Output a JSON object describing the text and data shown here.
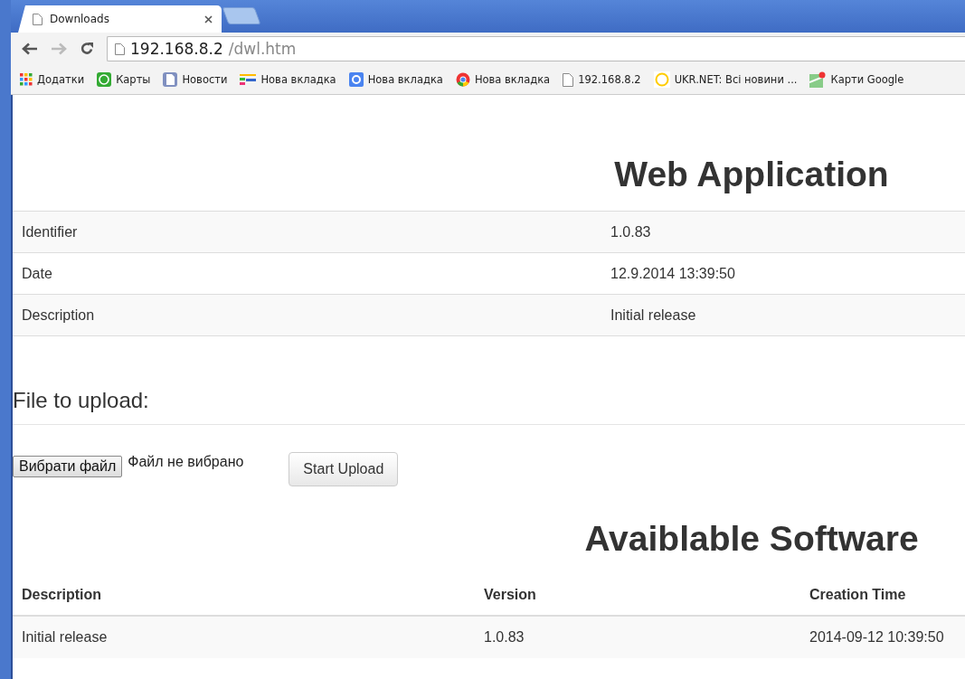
{
  "tabs": [
    {
      "title": "Downloads",
      "selected": true
    }
  ],
  "address": {
    "host": "192.168.8.2",
    "path": "/dwl.htm"
  },
  "bookmarks": [
    {
      "label": "Додатки"
    },
    {
      "label": "Карты"
    },
    {
      "label": "Новости"
    },
    {
      "label": "Нова вкладка"
    },
    {
      "label": "Нова вкладка"
    },
    {
      "label": "Нова вкладка"
    },
    {
      "label": "192.168.8.2"
    },
    {
      "label": "UKR.NET: Всі новини ..."
    },
    {
      "label": "Карти Google"
    }
  ],
  "app": {
    "title": "Web Application",
    "rows": [
      {
        "label": "Identifier",
        "value": "1.0.83"
      },
      {
        "label": "Date",
        "value": "12.9.2014 13:39:50"
      },
      {
        "label": "Description",
        "value": "Initial release"
      }
    ]
  },
  "upload": {
    "legend": "File to upload:",
    "choose_button": "Вибрати файл",
    "file_status": "Файл не вибрано",
    "upload_button": "Start Upload"
  },
  "software": {
    "title": "Avaiblable Software",
    "columns": [
      "Description",
      "Version",
      "Creation Time"
    ],
    "rows": [
      [
        "Initial release",
        "1.0.83",
        "2014-09-12 10:39:50"
      ]
    ]
  }
}
